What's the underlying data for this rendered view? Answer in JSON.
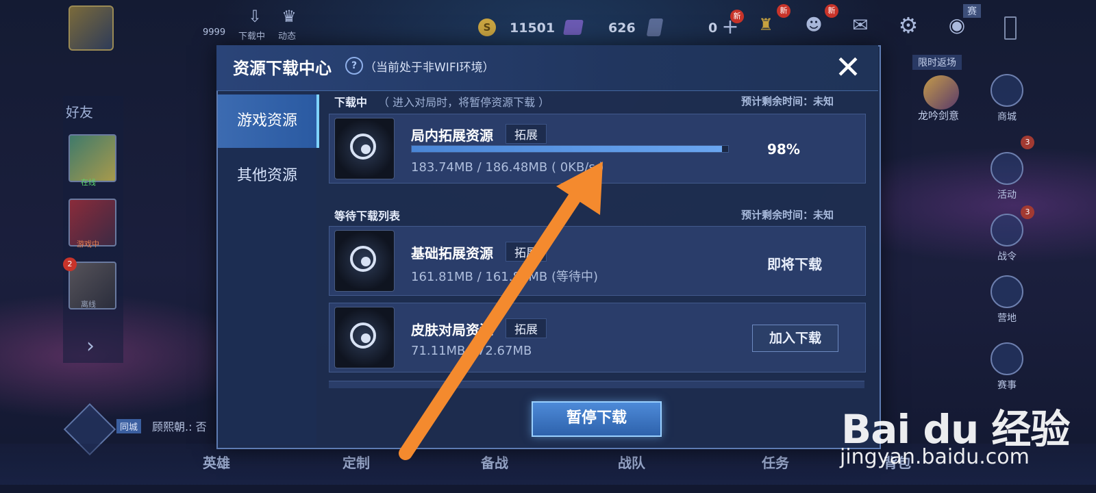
{
  "top_bar": {
    "level_label": "9999",
    "download_label": "下载中",
    "moments_label": "动态",
    "coins": "11501",
    "gems": "626",
    "vouchers": "0",
    "new_label": "新",
    "match_label": "赛"
  },
  "friends": {
    "header": "好友",
    "statuses": [
      "在线",
      "游戏中",
      "离线"
    ],
    "badge": "2",
    "chat_name": "顾熙朝.: 否",
    "chat_tag": "同城"
  },
  "right_menu": {
    "limited_label": "限时返场",
    "hero_label": "龙吟剑意",
    "items": [
      "商城",
      "活动",
      "战令",
      "营地",
      "赛事"
    ],
    "badges": [
      "3",
      "3"
    ]
  },
  "bottom_nav": [
    "英雄",
    "定制",
    "备战",
    "战队",
    "任务",
    "背包"
  ],
  "dialog": {
    "title": "资源下载中心",
    "subtitle": "（当前处于非WIFI环境）",
    "tabs": [
      "游戏资源",
      "其他资源"
    ],
    "downloading": {
      "label": "下载中",
      "note": "（ 进入对局时，将暂停资源下载 ）",
      "eta": "预计剩余时间：未知",
      "item": {
        "name": "局内拓展资源",
        "tag": "拓展",
        "size": "183.74MB / 186.48MB ( 0KB/s )",
        "progress": 0.98,
        "percent": "98%"
      }
    },
    "queue": {
      "label": "等待下载列表",
      "eta": "预计剩余时间：未知",
      "items": [
        {
          "name": "基础拓展资源",
          "tag": "拓展",
          "size": "161.81MB / 161.81MB (等待中)",
          "action": "即将下载"
        },
        {
          "name": "皮肤对局资源",
          "tag": "拓展",
          "size": "71.11MB / 72.67MB",
          "action": "加入下载"
        }
      ]
    },
    "pause_button": "暂停下载"
  },
  "watermark": {
    "logo": "Bai du 经验",
    "url": "jingyan.baidu.com"
  },
  "colors": {
    "accent": "#4a86d6",
    "arrow": "#f48a2e",
    "dialog_bg": "#1e2d50"
  }
}
